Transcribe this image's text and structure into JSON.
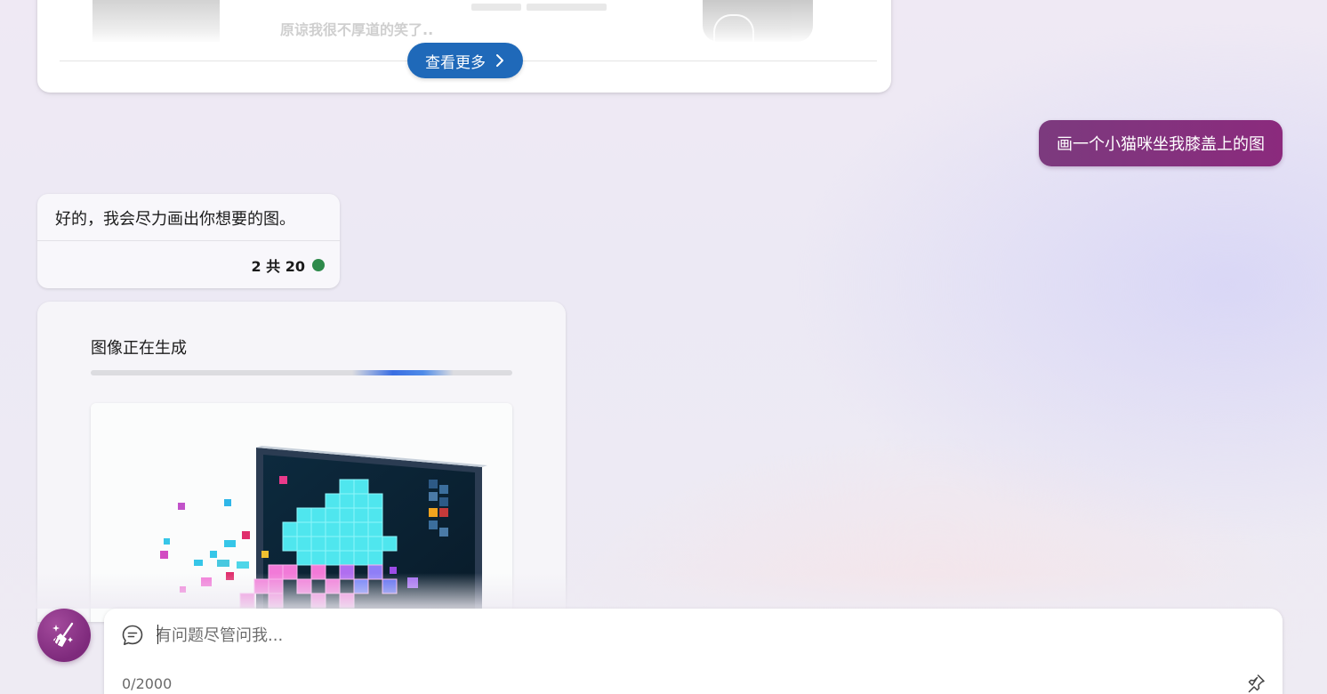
{
  "results_card": {
    "snippet_text": "原谅我很不厚道的笑了..",
    "see_more_label": "查看更多"
  },
  "conversation": {
    "user_message": "画一个小猫咪坐我膝盖上的图",
    "assistant_reply": "好的，我会尽力画出你想要的图。",
    "turn_counter": "2 共 20",
    "status_color": "#2e8a4b"
  },
  "image_generation": {
    "status_text": "图像正在生成"
  },
  "composer": {
    "placeholder": "有问题尽管问我...",
    "char_count": "0/2000"
  },
  "icons": {
    "new_topic": "broom-sparkle-icon",
    "chat": "chat-bubble-icon",
    "pin": "pin-icon",
    "chevron": "chevron-right-icon"
  },
  "colors": {
    "accent_purple": "#8b2a7d",
    "button_blue": "#1f69b9",
    "progress_blue": "#3a6ee2"
  }
}
